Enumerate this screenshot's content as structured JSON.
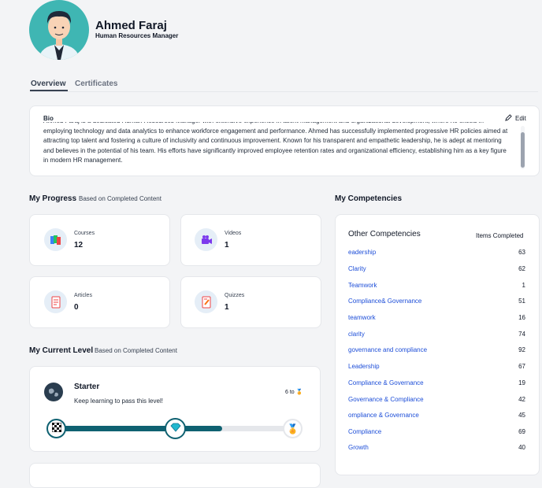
{
  "profile": {
    "name": "Ahmed Faraj",
    "role": "Human Resources Manager"
  },
  "tabs": [
    "Overview",
    "Certificates"
  ],
  "bio": {
    "title": "Bio",
    "edit_label": "Edit",
    "text": "Ahmed Faraj is a dedicated Human Resources Manager with extensive experience in talent management and organizational development, where he excels in employing technology and data analytics to enhance workforce engagement and performance. Ahmed has successfully implemented progressive HR policies aimed at attracting top talent and fostering a culture of inclusivity and continuous improvement. Known for his transparent and empathetic leadership, he is adept at mentoring and believes in the potential of his team. His efforts have significantly improved employee retention rates and organizational efficiency, establishing him as a key figure in modern HR management."
  },
  "progress": {
    "title": "My Progress",
    "subtitle": "Based on Completed Content",
    "stats": [
      {
        "label": "Courses",
        "value": "12",
        "icon": "courses-icon"
      },
      {
        "label": "Videos",
        "value": "1",
        "icon": "videos-icon"
      },
      {
        "label": "Articles",
        "value": "0",
        "icon": "articles-icon"
      },
      {
        "label": "Quizzes",
        "value": "1",
        "icon": "quizzes-icon"
      }
    ]
  },
  "level": {
    "title": "My Current Level",
    "subtitle": "Based on Completed Content",
    "name": "Starter",
    "description": "Keep learning to pass this level!",
    "next": "6 to",
    "progress_fraction": 0.7
  },
  "competencies": {
    "title": "My Competencies",
    "header_left": "Other Competencies",
    "header_right": "Items Completed",
    "items": [
      {
        "label": "eadership",
        "count": "63"
      },
      {
        "label": "Clarity",
        "count": "62"
      },
      {
        "label": "Teamwork",
        "count": "1"
      },
      {
        "label": "Compliance& Governance",
        "count": "51"
      },
      {
        "label": "teamwork",
        "count": "16"
      },
      {
        "label": "clarity",
        "count": "74"
      },
      {
        "label": "governance and compliance",
        "count": "92"
      },
      {
        "label": "Leadership",
        "count": "67"
      },
      {
        "label": "Compliance & Governance",
        "count": "19"
      },
      {
        "label": "Governance & Compliance",
        "count": "42"
      },
      {
        "label": "ompliance & Governance",
        "count": "45"
      },
      {
        "label": "Compliance",
        "count": "69"
      },
      {
        "label": "Growth",
        "count": "40"
      }
    ]
  },
  "colors": {
    "accent": "#0f6171",
    "avatar_bg": "#3fb6b3",
    "link": "#1d4ed8"
  }
}
